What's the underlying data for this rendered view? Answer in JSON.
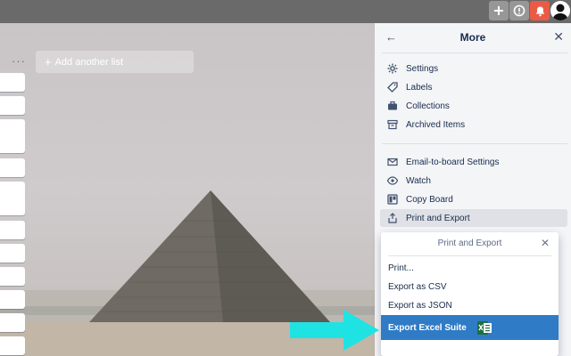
{
  "topbar": {
    "icons": [
      "plus-icon",
      "info-icon",
      "bell-icon",
      "avatar"
    ],
    "bell_color": "#eb5a46"
  },
  "board": {
    "list_menu": "···",
    "add_list_label": "Add another list"
  },
  "sidebar": {
    "title": "More",
    "back_icon": "arrow-left-icon",
    "close_icon": "close-icon",
    "group1": [
      {
        "label": "Settings",
        "icon": "gear-icon"
      },
      {
        "label": "Labels",
        "icon": "tag-icon"
      },
      {
        "label": "Collections",
        "icon": "briefcase-icon"
      },
      {
        "label": "Archived Items",
        "icon": "archive-icon"
      }
    ],
    "group2": [
      {
        "label": "Email-to-board Settings",
        "icon": "email-icon"
      },
      {
        "label": "Watch",
        "icon": "eye-icon"
      },
      {
        "label": "Copy Board",
        "icon": "copy-board-icon"
      },
      {
        "label": "Print and Export",
        "icon": "share-icon"
      }
    ]
  },
  "popover": {
    "title": "Print and Export",
    "items": [
      "Print...",
      "Export as CSV",
      "Export as JSON",
      "Export Excel Suite"
    ],
    "highlight_color": "#2f7bc5"
  },
  "annotation": {
    "arrow_color": "#1fe3e3"
  }
}
